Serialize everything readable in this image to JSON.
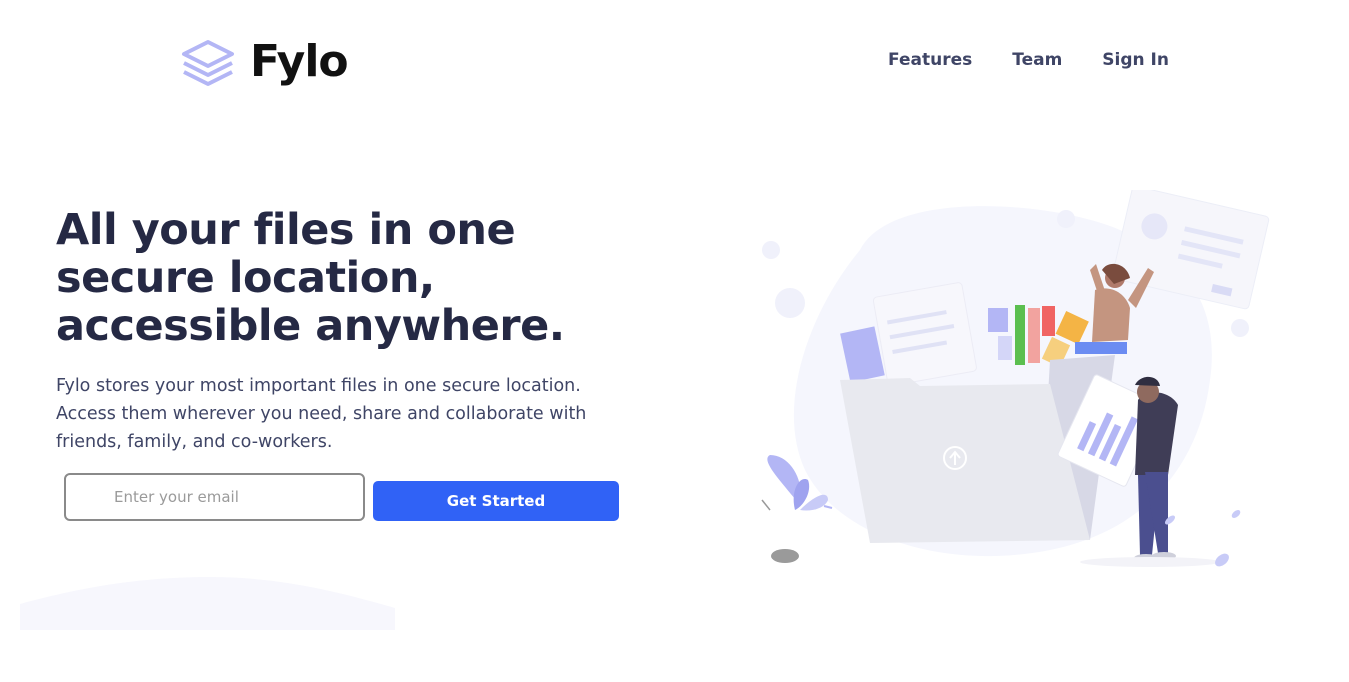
{
  "brand": {
    "name": "Fylo",
    "icon": "stacked-layers-logo-icon",
    "accent_color": "#b3b6f5"
  },
  "nav": {
    "items": [
      {
        "label": "Features"
      },
      {
        "label": "Team"
      },
      {
        "label": "Sign In"
      }
    ]
  },
  "hero": {
    "title": "All your files in one secure location, accessible anywhere.",
    "description": "Fylo stores your most important files in one secure location. Access them wherever you need, share and collaborate with friends, family, and co-workers.",
    "email_placeholder": "Enter your email",
    "email_value": "",
    "cta_label": "Get Started",
    "cta_color": "#3062f6"
  },
  "illustration": {
    "icon": "file-folder-collaboration-illustration"
  }
}
